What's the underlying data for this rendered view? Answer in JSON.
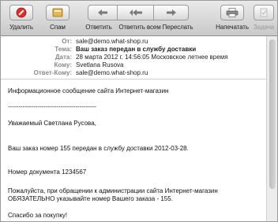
{
  "toolbar": {
    "buttons": [
      {
        "label": "Удалить",
        "icon": "delete-icon"
      },
      {
        "label": "Спам",
        "icon": "junk-icon"
      },
      {
        "label": "Ответить",
        "icon": "reply-icon"
      },
      {
        "label": "Ответить всем",
        "icon": "reply-all-icon"
      },
      {
        "label": "Переслать",
        "icon": "forward-icon"
      },
      {
        "label": "Напечатать",
        "icon": "print-icon"
      },
      {
        "label": "Задача",
        "icon": "task-icon"
      }
    ]
  },
  "headers": [
    {
      "key": "От:",
      "value": "sale@demo.what-shop.ru"
    },
    {
      "key": "Тема:",
      "value": "Ваш заказ передан в службу доставки"
    },
    {
      "key": "Дата:",
      "value": "28 марта 2012 г. 14:56:05 Московское летнее время"
    },
    {
      "key": "Кому:",
      "value": "Svetlana Rusova"
    },
    {
      "key": "Ответ-Кому:",
      "value": "sale@demo.what-shop.ru"
    }
  ],
  "body": {
    "lines": [
      "Информационное сообщение сайта Интернет-магазин",
      "------------------------------------------",
      "Уважаемый Светлана Русова,",
      "Ваш заказ номер 155 передан в службу доставки 2012-03-28.",
      "Номер документа 1234567",
      "Пожалуйста, при обращении к администрации сайта Интернет-магазин",
      "ОБЯЗАТЕЛЬНО указывайте номер Вашего заказа - 155.",
      "Спасибо за покупку!"
    ]
  }
}
